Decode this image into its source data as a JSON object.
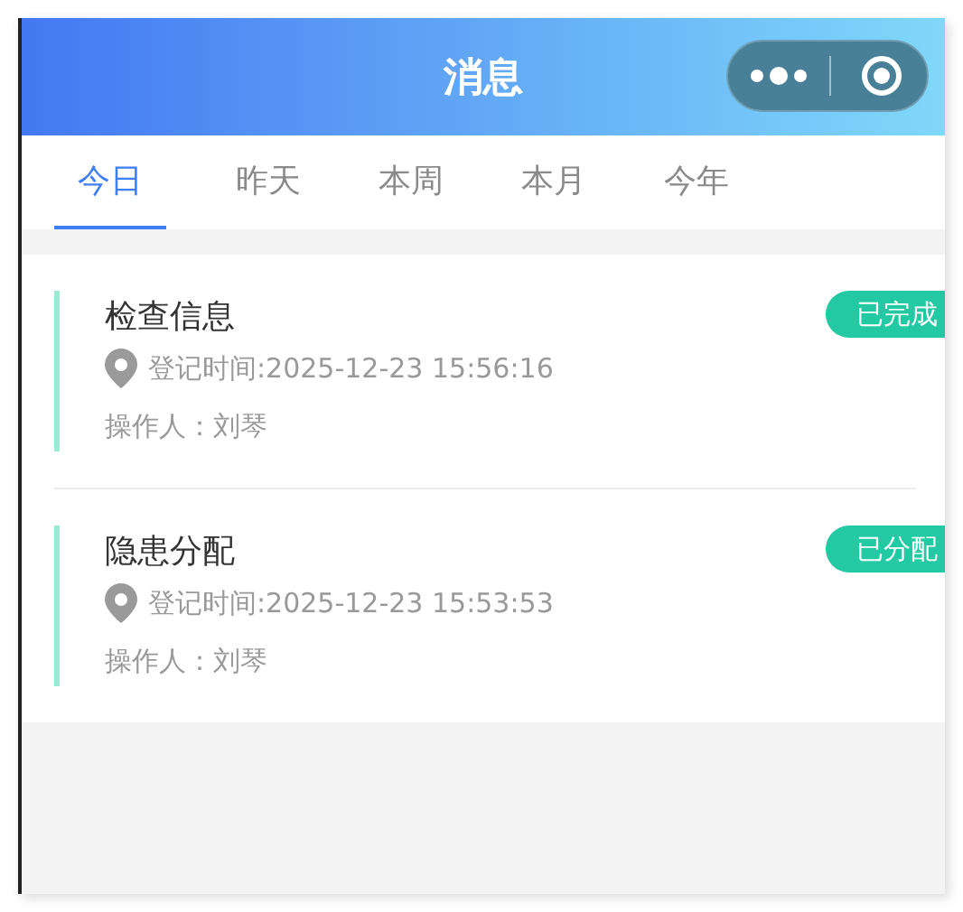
{
  "header": {
    "title": "消息"
  },
  "tabs": [
    {
      "label": "今日",
      "selected": true
    },
    {
      "label": "昨天",
      "selected": false
    },
    {
      "label": "本周",
      "selected": false
    },
    {
      "label": "本月",
      "selected": false
    },
    {
      "label": "今年",
      "selected": false
    }
  ],
  "messages": [
    {
      "title": "检查信息",
      "time": "登记时间:2025-12-23 15:56:16",
      "operator": "操作人：刘琴",
      "status": "已完成"
    },
    {
      "title": "隐患分配",
      "time": "登记时间:2025-12-23 15:53:53",
      "operator": "操作人：刘琴",
      "status": "已分配"
    }
  ]
}
